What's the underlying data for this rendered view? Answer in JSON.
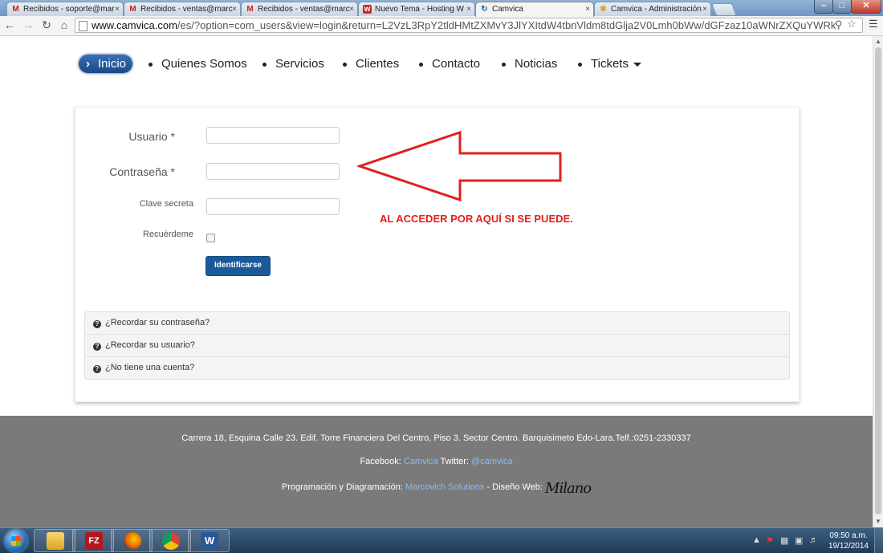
{
  "browser": {
    "tabs": [
      {
        "title": "Recibidos - soporte@mar",
        "icon": "gmail-icon"
      },
      {
        "title": "Recibidos - ventas@marc",
        "icon": "gmail-icon"
      },
      {
        "title": "Recibidos - ventas@marc",
        "icon": "gmail-icon"
      },
      {
        "title": "Nuevo Tema - Hosting W",
        "icon": "hosting-icon"
      },
      {
        "title": "Camvica",
        "icon": "camvica-icon"
      },
      {
        "title": "Camvica - Administración",
        "icon": "joomla-icon"
      }
    ],
    "url_host": "www.camvica.com",
    "url_path": "/es/?option=com_users&view=login&return=L2VzL3RpY2tldHMtZXMvY3JlYXItdW4tbnVldm8tdGlja2V0Lmh0bWw/dGFzaz10aWNrZXQuYWRk",
    "tab_close_glyph": "×"
  },
  "nav": {
    "active": "Inicio",
    "items": [
      "Quienes Somos",
      "Servicios",
      "Clientes",
      "Contacto",
      "Noticias",
      "Tickets"
    ]
  },
  "form": {
    "username_label": "Usuario",
    "password_label": "Contraseña",
    "secret_label": "Clave secreta",
    "remember_label": "Recuérdeme",
    "required_mark": "*",
    "submit_label": "Identificarse"
  },
  "annotation": {
    "text": "AL ACCEDER POR AQUÍ SI SE PUEDE.",
    "color": "#e02020"
  },
  "links": [
    "¿Recordar su contraseña?",
    "¿Recordar su usuario?",
    "¿No tiene una cuenta?"
  ],
  "footer": {
    "address": "Carrera 18, Esquina Calle 23. Edif. Torre Financiera Del Centro, Piso 3. Sector Centro. Barquisimeto Edo-Lara.Telf.:0251-2330337",
    "facebook_label": "Facebook:",
    "facebook_link": "Camvica",
    "twitter_label": "Twitter:",
    "twitter_link": "@camvica",
    "programming_label": "Programación y Diagramación:",
    "programming_link": "Marcovich Solutions",
    "design_label": "- Diseño Web:",
    "design_signature": "Milano"
  },
  "taskbar": {
    "apps": [
      {
        "name": "explorer",
        "icon": "folder-icon",
        "glyph": ""
      },
      {
        "name": "filezilla",
        "icon": "filezilla-icon",
        "glyph": "FZ"
      },
      {
        "name": "firefox",
        "icon": "firefox-icon",
        "glyph": ""
      },
      {
        "name": "chrome",
        "icon": "chrome-icon",
        "glyph": ""
      },
      {
        "name": "word",
        "icon": "word-icon",
        "glyph": "W"
      }
    ],
    "time": "09:50 a.m.",
    "date": "19/12/2014"
  },
  "colors": {
    "brand_blue": "#1b5a99",
    "footer_bg": "#7a7a7a",
    "link_blue": "#8dbcf0"
  }
}
